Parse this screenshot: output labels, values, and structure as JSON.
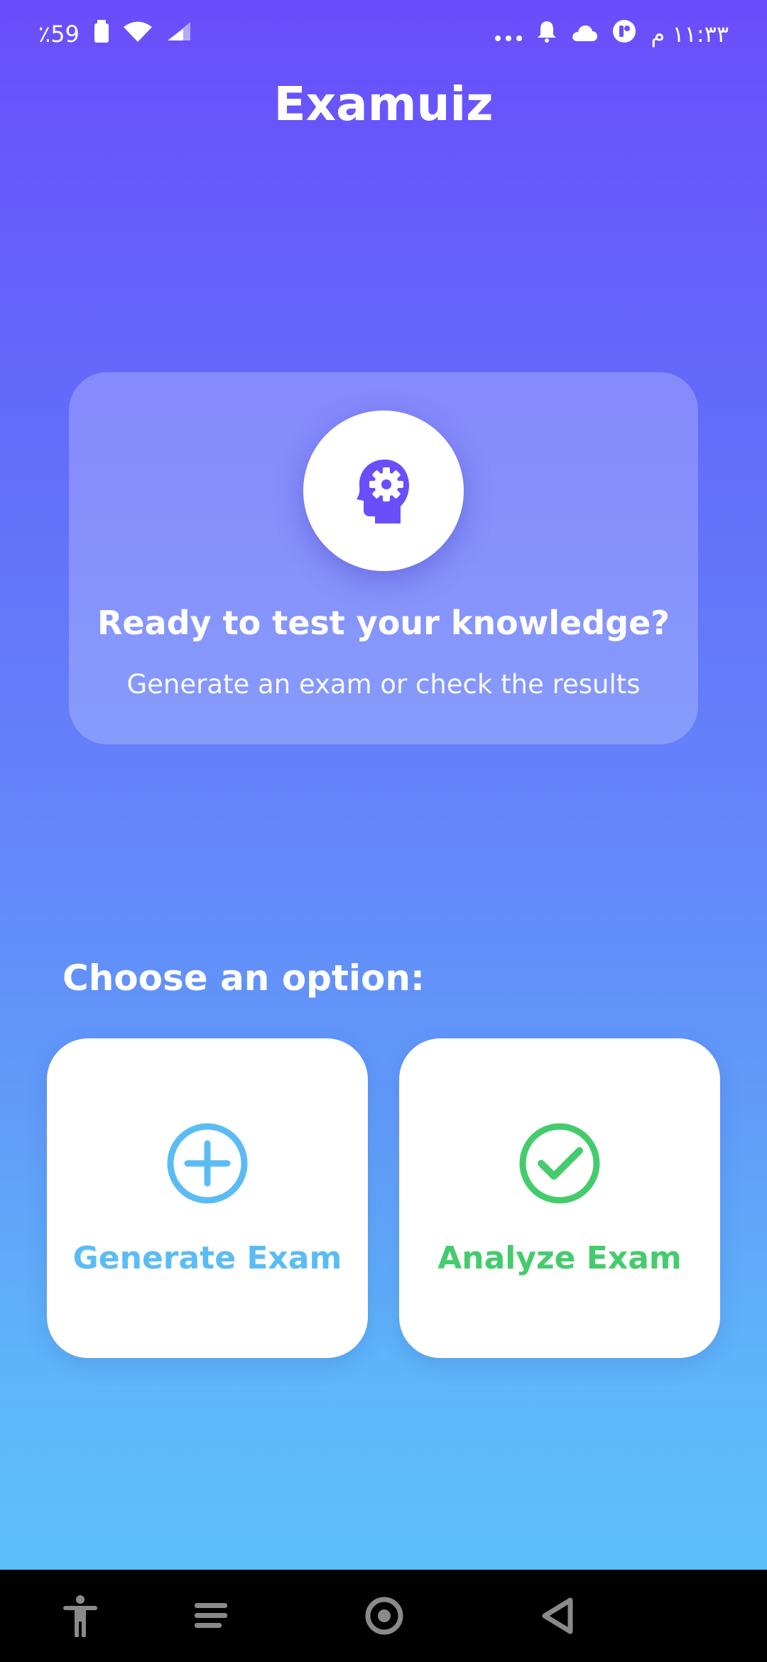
{
  "status_bar": {
    "battery_percent": "٪59",
    "time": "١١:٣٣ م",
    "icons": [
      "battery-icon",
      "wifi-icon",
      "signal-icon",
      "more-dots-icon",
      "bell-icon",
      "cloud-icon",
      "app-badge-icon"
    ]
  },
  "app": {
    "title": "Examuiz"
  },
  "hero": {
    "icon": "brain-gear-icon",
    "heading": "Ready to test your knowledge?",
    "subtitle": "Generate an exam or check the results"
  },
  "options": {
    "label": "Choose an option:",
    "generate": {
      "label": "Generate Exam",
      "icon": "plus-circle-icon",
      "color": "#5bbcf4"
    },
    "analyze": {
      "label": "Analyze Exam",
      "icon": "check-circle-icon",
      "color": "#44cc6c"
    }
  },
  "nav_bar": {
    "icons": [
      "accessibility-icon",
      "recents-icon",
      "home-icon",
      "back-icon"
    ]
  },
  "colors": {
    "primary": "#6a4dfb",
    "gradient_end": "#5cc6fa"
  }
}
